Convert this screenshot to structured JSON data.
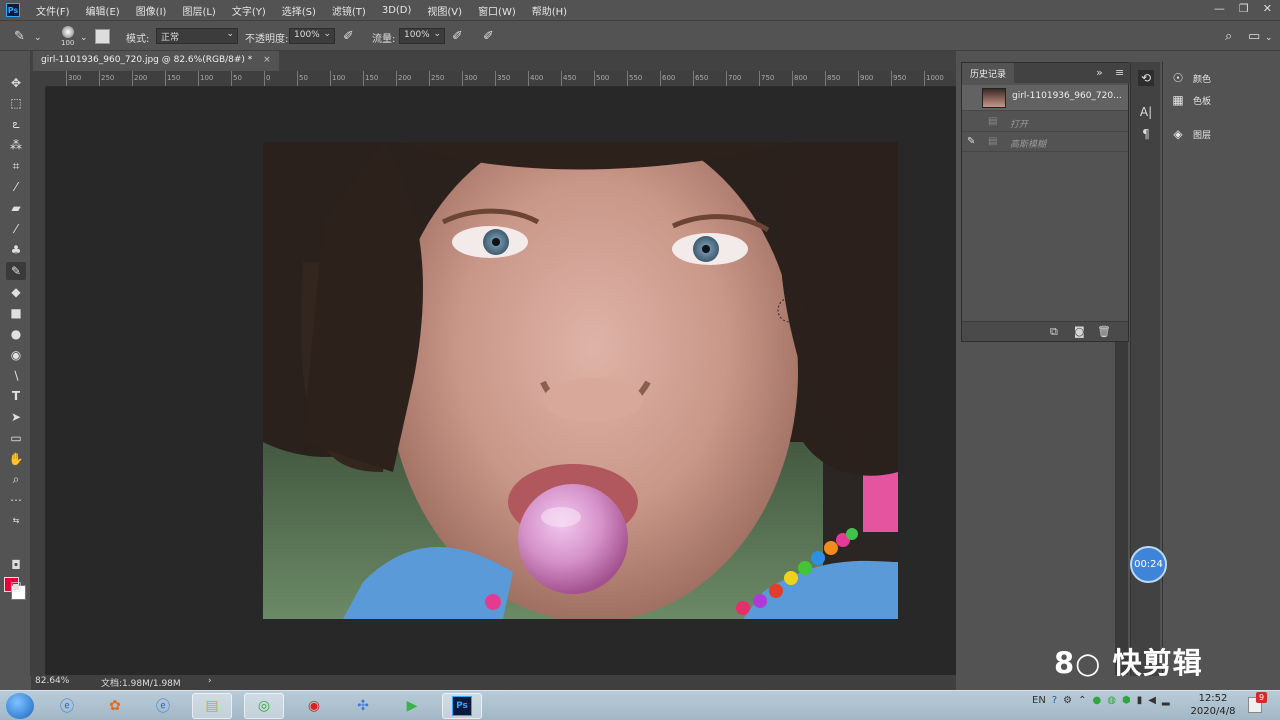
{
  "app": {
    "logo_text": "Ps"
  },
  "menu": [
    "文件(F)",
    "编辑(E)",
    "图像(I)",
    "图层(L)",
    "文字(Y)",
    "选择(S)",
    "滤镜(T)",
    "3D(D)",
    "视图(V)",
    "窗口(W)",
    "帮助(H)"
  ],
  "window_controls": {
    "minimize": "—",
    "restore": "❐",
    "close": "✕"
  },
  "options_bar": {
    "brush_size": "100",
    "mode_label": "模式:",
    "mode_value": "正常",
    "opacity_label": "不透明度:",
    "opacity_value": "100%",
    "flow_label": "流量:",
    "flow_value": "100%"
  },
  "document": {
    "tab_title": "girl-1101936_960_720.jpg @ 82.6%(RGB/8#) *",
    "close": "×"
  },
  "ruler": {
    "h_ticks": [
      "300",
      "250",
      "200",
      "150",
      "100",
      "50",
      "0",
      "50",
      "100",
      "150",
      "200",
      "250",
      "300",
      "350",
      "400",
      "450",
      "500",
      "550",
      "600",
      "650",
      "700",
      "750",
      "800",
      "850",
      "900",
      "950",
      "1000"
    ]
  },
  "status_bar": {
    "zoom": "82.64%",
    "doc_info": "文档:1.98M/1.98M",
    "arrow": "›"
  },
  "history_panel": {
    "tab": "历史记录",
    "collapse": "»",
    "menu": "≡",
    "snapshot_label": "girl-1101936_960_720...",
    "steps": [
      "打开",
      "高斯模糊"
    ]
  },
  "right_dock": {
    "items": [
      {
        "label": "颜色",
        "icon": "color-wheel-icon"
      },
      {
        "label": "色板",
        "icon": "swatches-grid-icon"
      },
      {
        "label": "图层",
        "icon": "layers-icon"
      }
    ]
  },
  "timer": {
    "text": "00:24"
  },
  "watermark": {
    "text": "8○ 快剪辑"
  },
  "taskbar": {
    "tray_lang": "EN",
    "clock_time": "12:52",
    "clock_date": "2020/4/8",
    "notify_count": "9"
  },
  "colors": {
    "foreground": "#e8003a",
    "background": "#ffffff",
    "accent": "#31a8ff"
  }
}
